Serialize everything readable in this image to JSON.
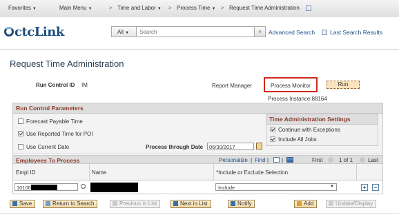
{
  "nav": {
    "favorites": "Favorites",
    "main_menu": "Main Menu",
    "time_labor": "Time and Labor",
    "process_time": "Process Time",
    "current": "Request Time Administration",
    "sep": ">"
  },
  "header": {
    "logo": "ctcLink",
    "search_scope": "All",
    "search_placeholder": "Search",
    "search_go": "»",
    "advanced_search": "Advanced Search",
    "last_results": "Last Search Results"
  },
  "page": {
    "title": "Request Time Administration",
    "run_control_label": "Run Control ID",
    "run_control_value": "IM",
    "report_manager": "Report Manager",
    "process_monitor": "Process Monitor",
    "run_button": "Run",
    "process_instance": "Process Instance:88164"
  },
  "params": {
    "heading": "Run Control Parameters",
    "forecast": "Forecast Payable Time",
    "use_reported": "Use Reported Time for POI",
    "use_current_date": "Use Current Date",
    "process_through_label": "Process through Date",
    "process_through_value": "06/30/2017"
  },
  "settings": {
    "heading": "Time Administration Settings",
    "continue_exceptions": "Continue with Exceptions",
    "include_all_jobs": "Include All Jobs"
  },
  "employees": {
    "heading": "Employees To Process",
    "personalize": "Personalize",
    "pipe": "|",
    "find": "Find",
    "first": "First",
    "pager": "1 of 1",
    "last": "Last",
    "col_empl": "Empl ID",
    "col_name": "Name",
    "col_include": "*Include or Exclude Selection",
    "row_empl": "10100",
    "row_include": "Include",
    "add_row": "+",
    "del_row": "−"
  },
  "toolbar": {
    "save": "Save",
    "return": "Return to Search",
    "previous": "Previous in List",
    "next": "Next in List",
    "notify": "Notify",
    "add": "Add",
    "update": "Update/Display"
  },
  "colors": {
    "accent": "#1a4f8b",
    "section_title": "#8a3b2b",
    "highlight": "#d0271b"
  }
}
